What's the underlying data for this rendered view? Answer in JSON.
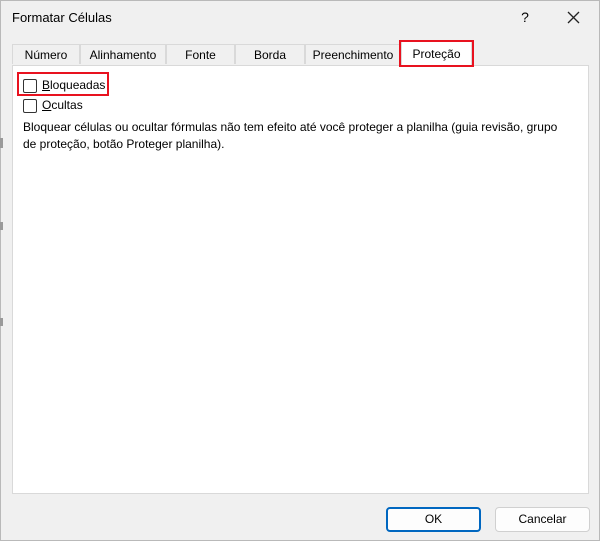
{
  "window": {
    "title": "Formatar Células",
    "help_label": "?"
  },
  "tabs": [
    {
      "label": "Número",
      "active": false
    },
    {
      "label": "Alinhamento",
      "active": false
    },
    {
      "label": "Fonte",
      "active": false
    },
    {
      "label": "Borda",
      "active": false
    },
    {
      "label": "Preenchimento",
      "active": false
    },
    {
      "label": "Proteção",
      "active": true
    }
  ],
  "protection": {
    "locked": {
      "label_underlined": "B",
      "label_rest": "loqueadas",
      "checked": false
    },
    "hidden": {
      "label_underlined": "O",
      "label_rest": "cultas",
      "checked": false
    },
    "description": "Bloquear células ou ocultar fórmulas não tem efeito até você proteger a planilha (guia revisão, grupo de proteção, botão Proteger planilha)."
  },
  "buttons": {
    "ok_label": "OK",
    "cancel_label": "Cancelar"
  },
  "colors": {
    "highlight": "#e8121f",
    "primary_button_border": "#0067c0",
    "dialog_bg": "#f0f0f0"
  },
  "icons": {
    "close": "close-icon",
    "help": "help-icon"
  }
}
